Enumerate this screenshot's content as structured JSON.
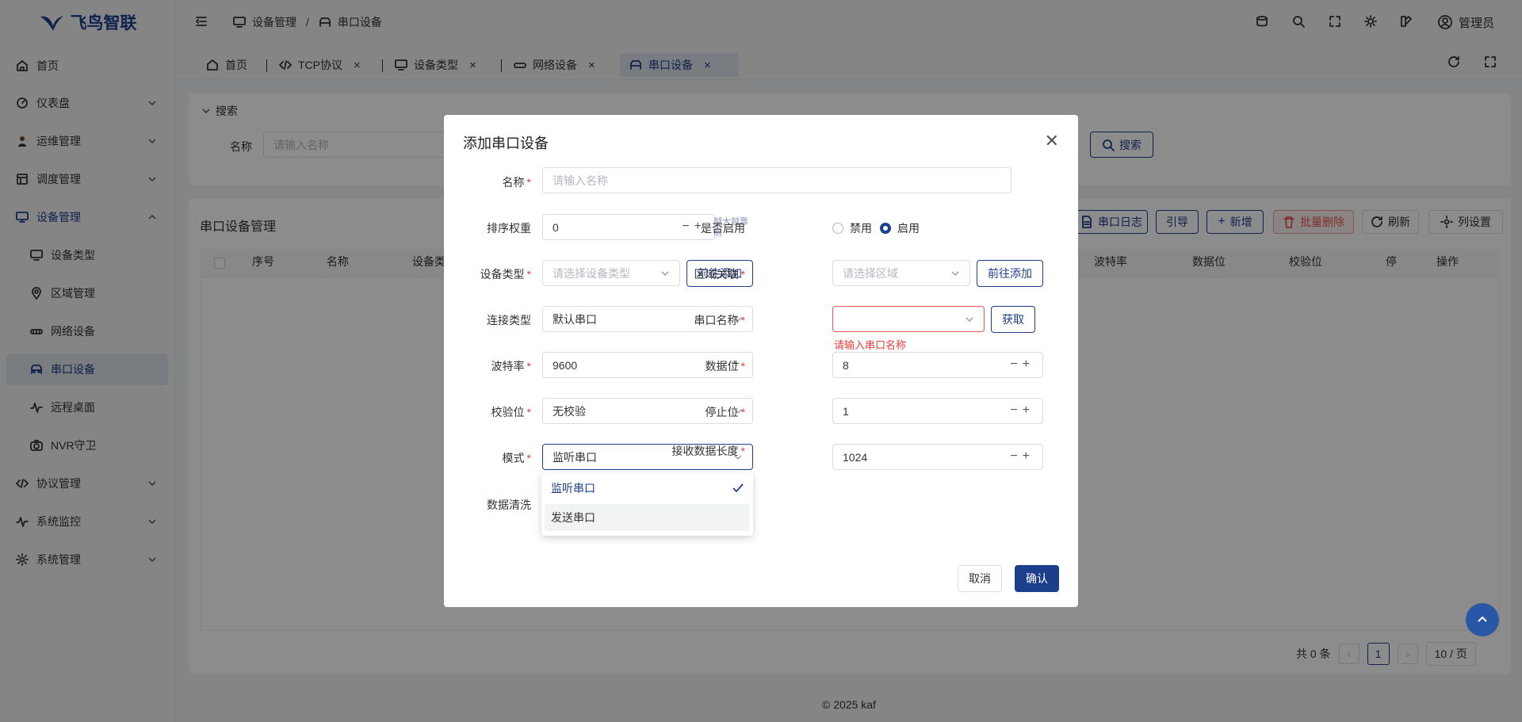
{
  "app": {
    "brand": "飞鸟智联",
    "brand_color": "#1c3f8c"
  },
  "sidebar": {
    "items": [
      {
        "label": "首页",
        "icon": "home-icon"
      },
      {
        "label": "仪表盘",
        "icon": "dashboard-icon"
      },
      {
        "label": "运维管理",
        "icon": "user-avatar-icon"
      },
      {
        "label": "调度管理",
        "icon": "schedule-icon"
      },
      {
        "label": "设备管理",
        "icon": "device-icon"
      },
      {
        "label": "设备类型",
        "icon": "device-type-icon"
      },
      {
        "label": "区域管理",
        "icon": "location-icon"
      },
      {
        "label": "网络设备",
        "icon": "network-icon"
      },
      {
        "label": "串口设备",
        "icon": "serial-icon"
      },
      {
        "label": "远程桌面",
        "icon": "pulse-icon"
      },
      {
        "label": "NVR守卫",
        "icon": "camera-icon"
      },
      {
        "label": "协议管理",
        "icon": "code-icon"
      },
      {
        "label": "系统监控",
        "icon": "pulse-icon"
      },
      {
        "label": "系统管理",
        "icon": "gear-icon"
      }
    ]
  },
  "header": {
    "breadcrumb": [
      "设备管理",
      "/",
      "串口设备"
    ],
    "user": "管理员"
  },
  "tabs": [
    {
      "label": "首页"
    },
    {
      "label": "TCP协议"
    },
    {
      "label": "设备类型"
    },
    {
      "label": "网络设备"
    },
    {
      "label": "串口设备"
    }
  ],
  "search": {
    "title": "搜索",
    "name_label": "名称",
    "name_placeholder": "请输入名称",
    "search_button": "搜索"
  },
  "table": {
    "title": "串口设备管理",
    "toolbar": [
      "串口日志",
      "引导",
      "新增",
      "批量删除",
      "刷新",
      "列设置"
    ],
    "columns": [
      "序号",
      "名称",
      "设备类",
      "波特率",
      "数据位",
      "校验位",
      "停",
      "操作"
    ],
    "pagination": {
      "total": "共 0 条",
      "page": "1",
      "page_size": "10 / 页"
    }
  },
  "footer": "© 2025 kaf",
  "modal": {
    "title": "添加串口设备",
    "fields": {
      "name": {
        "label": "名称",
        "placeholder": "请输入名称"
      },
      "sort": {
        "label": "排序权重",
        "value": "0",
        "hint": "越大越靠前"
      },
      "enabled": {
        "label": "是否启用",
        "off": "禁用",
        "on": "启用",
        "selected": "启用"
      },
      "device_type": {
        "label": "设备类型",
        "placeholder": "请选择设备类型",
        "button": "前往添加"
      },
      "region": {
        "label": "区域关联",
        "placeholder": "请选择区域",
        "button": "前往添加"
      },
      "conn_type": {
        "label": "连接类型",
        "value": "默认串口"
      },
      "port_name": {
        "label": "串口名称",
        "button": "获取",
        "error": "请输入串口名称"
      },
      "baud": {
        "label": "波特率",
        "value": "9600"
      },
      "data_bits": {
        "label": "数据位",
        "value": "8"
      },
      "parity": {
        "label": "校验位",
        "value": "无校验"
      },
      "stop_bits": {
        "label": "停止位",
        "value": "1"
      },
      "mode": {
        "label": "模式",
        "value": "监听串口",
        "options": [
          "监听串口",
          "发送串口"
        ]
      },
      "recv_len": {
        "label": "接收数据长度",
        "value": "1024"
      },
      "cleanse": {
        "label": "数据清洗"
      }
    },
    "cancel": "取消",
    "confirm": "确认"
  }
}
